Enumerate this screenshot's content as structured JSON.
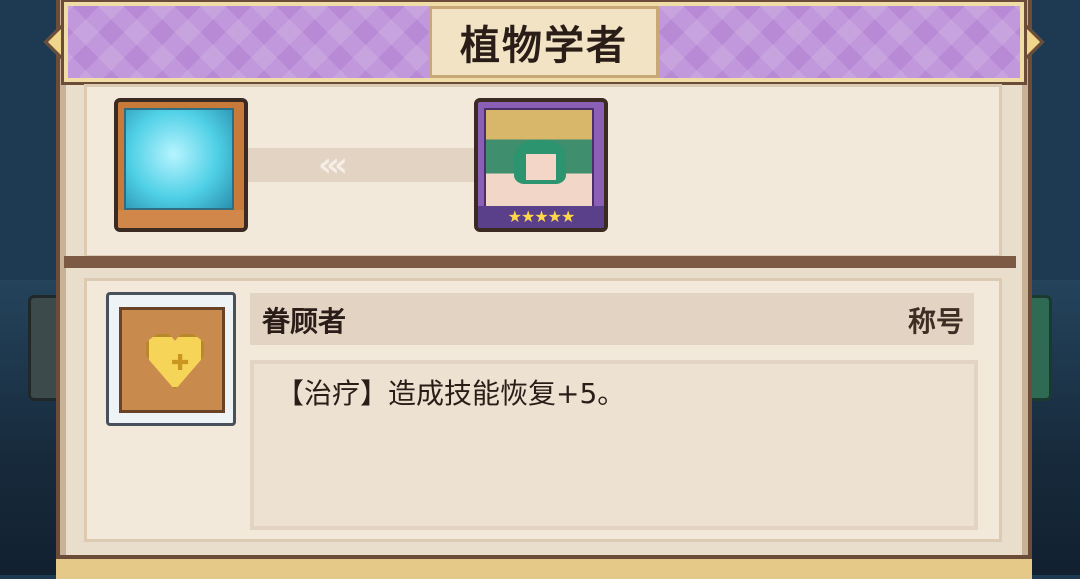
{
  "title": "植物学者",
  "evolution": {
    "chevrons": "‹‹‹",
    "target_stars": 5,
    "stars_text": "★★★★★"
  },
  "skill": {
    "name": "眷顾者",
    "tag": "称号",
    "description": "【治疗】造成技能恢复+5。",
    "icon": "heart-cross-icon"
  },
  "colors": {
    "title_bar": "#b88ad6",
    "panel": "#e9ddcb",
    "frame": "#6a4c38",
    "star": "#ffd84a"
  }
}
